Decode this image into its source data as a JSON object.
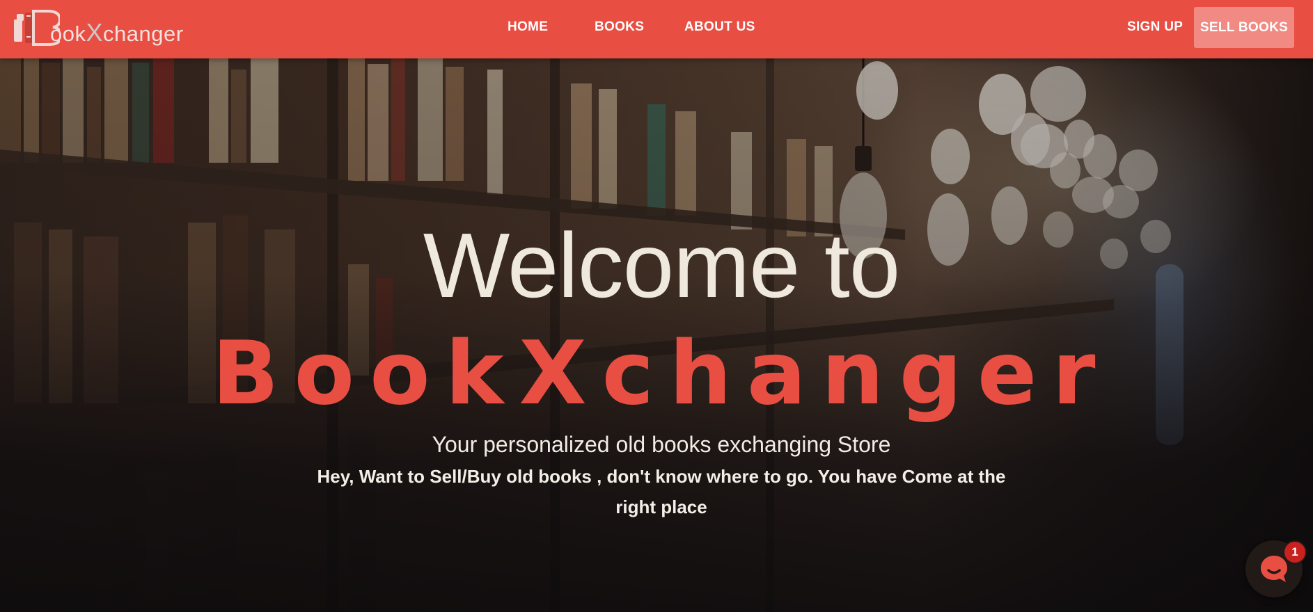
{
  "brand": {
    "logo_prefix": "ook",
    "logo_x": "X",
    "logo_suffix": "changer"
  },
  "nav": {
    "links": [
      "HOME",
      "BOOKS",
      "ABOUT US"
    ],
    "sign_up": "SIGN UP",
    "sell_books": "SELL BOOKS"
  },
  "hero": {
    "welcome": "Welcome to",
    "brand_name": "BookXchanger",
    "tagline": "Your personalized old books exchanging Store",
    "subtext": "Hey, Want to Sell/Buy old books , don't know where to go. You have Come at the right place"
  },
  "chat": {
    "badge_count": "1",
    "icon": "chat-bubble-icon"
  },
  "colors": {
    "brand_red": "#e94e43",
    "sell_button": "#f08a83",
    "headline_text": "#efe9dd",
    "badge_red": "#c8211f"
  }
}
